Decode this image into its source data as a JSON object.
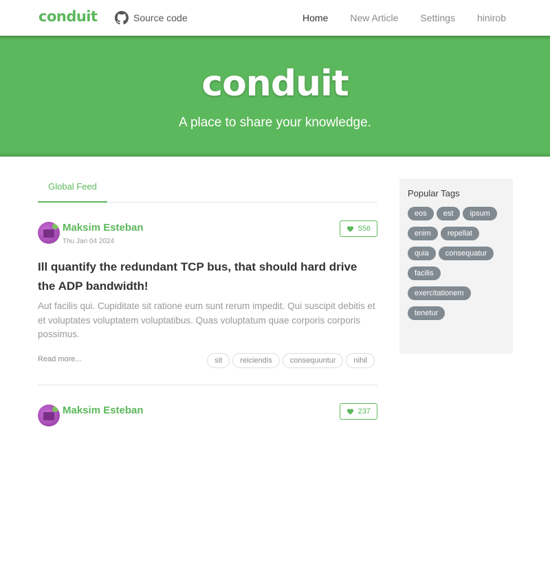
{
  "navbar": {
    "brand": "conduit",
    "source_label": "Source code",
    "links": [
      "Home",
      "New Article",
      "Settings",
      "hinirob"
    ]
  },
  "banner": {
    "title": "conduit",
    "subtitle": "A place to share your knowledge."
  },
  "feed": {
    "tab": "Global Feed",
    "articles": [
      {
        "author": "Maksim Esteban",
        "date": "Thu Jan 04 2024",
        "likes": "556",
        "title": "Ill quantify the redundant TCP bus, that should hard drive the ADP bandwidth!",
        "excerpt": "Aut facilis qui. Cupiditate sit ratione eum sunt rerum impedit. Qui suscipit debitis et et voluptates voluptatem voluptatibus. Quas voluptatum quae corporis corporis possimus.",
        "read_more": "Read more...",
        "tags": [
          "sit",
          "reiciendis",
          "consequuntur",
          "nihil"
        ]
      },
      {
        "author": "Maksim Esteban",
        "likes": "237"
      }
    ]
  },
  "sidebar": {
    "title": "Popular Tags",
    "tags": [
      "eos",
      "est",
      "ipsum",
      "enim",
      "repellat",
      "quia",
      "consequatur",
      "facilis",
      "exercitationem",
      "tenetur"
    ]
  },
  "colors": {
    "accent": "#5cb85c",
    "tag_pill": "#818a91"
  },
  "icons": {
    "source": "github-icon",
    "like": "heart-icon"
  }
}
